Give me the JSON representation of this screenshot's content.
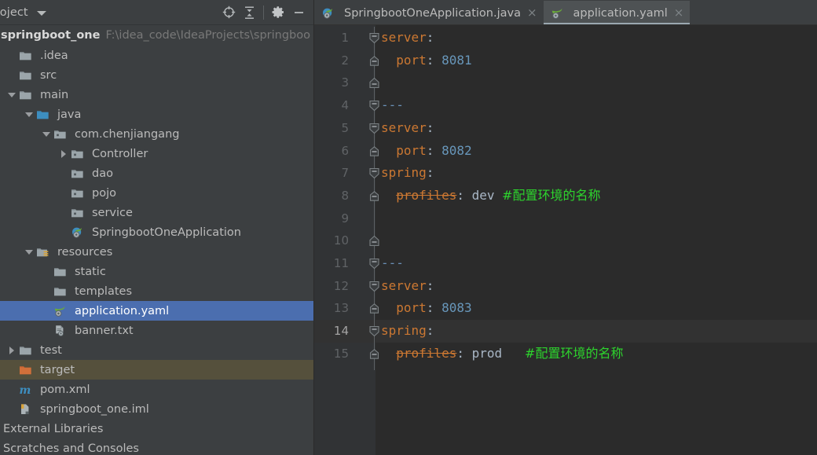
{
  "toolwindow": {
    "title": "roject",
    "icons": [
      {
        "name": "locate-icon",
        "glyph": "crosshair"
      },
      {
        "name": "collapse-all-icon",
        "glyph": "collapse"
      },
      {
        "name": "settings-gear-icon",
        "glyph": "gear"
      },
      {
        "name": "hide-window-icon",
        "glyph": "minus"
      }
    ]
  },
  "project": {
    "name": "springboot_one",
    "path": "F:\\idea_code\\IdeaProjects\\springboo"
  },
  "tree": {
    "items": [
      {
        "label": ".idea",
        "indent": 0,
        "arrow": "none",
        "icon": "folder-gray",
        "state": "normal"
      },
      {
        "label": "src",
        "indent": 0,
        "arrow": "none",
        "icon": "folder-gray",
        "state": "normal"
      },
      {
        "label": "main",
        "indent": 0,
        "arrow": "down",
        "icon": "folder-gray",
        "state": "normal"
      },
      {
        "label": "java",
        "indent": 1,
        "arrow": "down",
        "icon": "folder-blue",
        "state": "normal"
      },
      {
        "label": "com.chenjiangang",
        "indent": 2,
        "arrow": "down",
        "icon": "package",
        "state": "normal"
      },
      {
        "label": "Controller",
        "indent": 3,
        "arrow": "right",
        "icon": "package",
        "state": "normal"
      },
      {
        "label": "dao",
        "indent": 3,
        "arrow": "none",
        "icon": "package",
        "state": "normal"
      },
      {
        "label": "pojo",
        "indent": 3,
        "arrow": "none",
        "icon": "package",
        "state": "normal"
      },
      {
        "label": "service",
        "indent": 3,
        "arrow": "none",
        "icon": "package",
        "state": "normal"
      },
      {
        "label": "SpringbootOneApplication",
        "indent": 3,
        "arrow": "none",
        "icon": "spring-class",
        "state": "normal"
      },
      {
        "label": "resources",
        "indent": 1,
        "arrow": "down",
        "icon": "folder-resources",
        "state": "normal"
      },
      {
        "label": "static",
        "indent": 2,
        "arrow": "none",
        "icon": "folder-gray",
        "state": "normal"
      },
      {
        "label": "templates",
        "indent": 2,
        "arrow": "none",
        "icon": "folder-gray",
        "state": "normal"
      },
      {
        "label": "application.yaml",
        "indent": 2,
        "arrow": "none",
        "icon": "spring-yaml",
        "state": "selected"
      },
      {
        "label": "banner.txt",
        "indent": 2,
        "arrow": "none",
        "icon": "text-file",
        "state": "normal"
      },
      {
        "label": "test",
        "indent": 0,
        "arrow": "right",
        "icon": "folder-gray",
        "state": "normal"
      },
      {
        "label": "target",
        "indent": 0,
        "arrow": "none",
        "icon": "folder-orange",
        "state": "excluded"
      },
      {
        "label": "pom.xml",
        "indent": 0,
        "arrow": "none",
        "icon": "maven",
        "state": "normal"
      },
      {
        "label": "springboot_one.iml",
        "indent": 0,
        "arrow": "none",
        "icon": "iml",
        "state": "normal"
      },
      {
        "label": "External Libraries",
        "indent": -1,
        "arrow": "none",
        "icon": "none",
        "state": "normal"
      },
      {
        "label": "Scratches and Consoles",
        "indent": -1,
        "arrow": "none",
        "icon": "none",
        "state": "normal"
      }
    ]
  },
  "tabs": [
    {
      "label": "SpringbootOneApplication.java",
      "icon": "spring-class",
      "active": false,
      "close": "×"
    },
    {
      "label": "application.yaml",
      "icon": "spring-yaml",
      "active": true,
      "close": "×"
    }
  ],
  "editor": {
    "filename": "application.yaml",
    "current_line": 14,
    "lines": [
      {
        "n": 1,
        "fold": "start",
        "indent": 0,
        "tokens": [
          {
            "t": "server",
            "c": "k"
          },
          {
            "t": ":",
            "c": "val"
          }
        ]
      },
      {
        "n": 2,
        "fold": "mid",
        "indent": 0,
        "tokens": [
          {
            "t": "  ",
            "c": "val"
          },
          {
            "t": "port",
            "c": "k"
          },
          {
            "t": ": ",
            "c": "val"
          },
          {
            "t": "8081",
            "c": "num"
          }
        ]
      },
      {
        "n": 3,
        "fold": "end",
        "indent": 0,
        "tokens": []
      },
      {
        "n": 4,
        "fold": "start",
        "indent": 0,
        "tokens": [
          {
            "t": "---",
            "c": "doc"
          }
        ]
      },
      {
        "n": 5,
        "fold": "start",
        "indent": 0,
        "tokens": [
          {
            "t": "server",
            "c": "k"
          },
          {
            "t": ":",
            "c": "val"
          }
        ]
      },
      {
        "n": 6,
        "fold": "mid",
        "indent": 0,
        "tokens": [
          {
            "t": "  ",
            "c": "val"
          },
          {
            "t": "port",
            "c": "k"
          },
          {
            "t": ": ",
            "c": "val"
          },
          {
            "t": "8082",
            "c": "num"
          }
        ]
      },
      {
        "n": 7,
        "fold": "start",
        "indent": 0,
        "tokens": [
          {
            "t": "spring",
            "c": "k"
          },
          {
            "t": ":",
            "c": "val"
          }
        ]
      },
      {
        "n": 8,
        "fold": "mid",
        "indent": 0,
        "tokens": [
          {
            "t": "  ",
            "c": "val"
          },
          {
            "t": "profiles",
            "c": "dep"
          },
          {
            "t": ": ",
            "c": "val"
          },
          {
            "t": "dev",
            "c": "val"
          },
          {
            "t": " ",
            "c": "val"
          },
          {
            "t": "#配置环境的名称",
            "c": "cm"
          }
        ]
      },
      {
        "n": 9,
        "fold": "none",
        "indent": 0,
        "tokens": []
      },
      {
        "n": 10,
        "fold": "end",
        "indent": 0,
        "tokens": []
      },
      {
        "n": 11,
        "fold": "start",
        "indent": 0,
        "tokens": [
          {
            "t": "---",
            "c": "doc"
          }
        ]
      },
      {
        "n": 12,
        "fold": "start",
        "indent": 0,
        "tokens": [
          {
            "t": "server",
            "c": "k"
          },
          {
            "t": ":",
            "c": "val"
          }
        ]
      },
      {
        "n": 13,
        "fold": "mid",
        "indent": 0,
        "tokens": [
          {
            "t": "  ",
            "c": "val"
          },
          {
            "t": "port",
            "c": "k"
          },
          {
            "t": ": ",
            "c": "val"
          },
          {
            "t": "8083",
            "c": "num"
          }
        ]
      },
      {
        "n": 14,
        "fold": "start",
        "indent": 0,
        "tokens": [
          {
            "t": "spring",
            "c": "k"
          },
          {
            "t": ":",
            "c": "val"
          }
        ]
      },
      {
        "n": 15,
        "fold": "mid",
        "indent": 0,
        "tokens": [
          {
            "t": "  ",
            "c": "val"
          },
          {
            "t": "profiles",
            "c": "dep"
          },
          {
            "t": ": ",
            "c": "val"
          },
          {
            "t": "prod",
            "c": "val"
          },
          {
            "t": "   ",
            "c": "val"
          },
          {
            "t": "#配置环境的名称",
            "c": "cm"
          }
        ]
      }
    ]
  },
  "colors": {
    "panel_bg": "#3c3f41",
    "editor_bg": "#2b2b2b",
    "gutter_bg": "#313335",
    "selection_blue": "#4b6eaf",
    "excluded_olive": "#55503c",
    "current_line": "#323232",
    "key_orange": "#cc7832",
    "number_blue": "#6897bb",
    "comment_green": "#2dd42d",
    "text_gray": "#a9b7c6"
  }
}
